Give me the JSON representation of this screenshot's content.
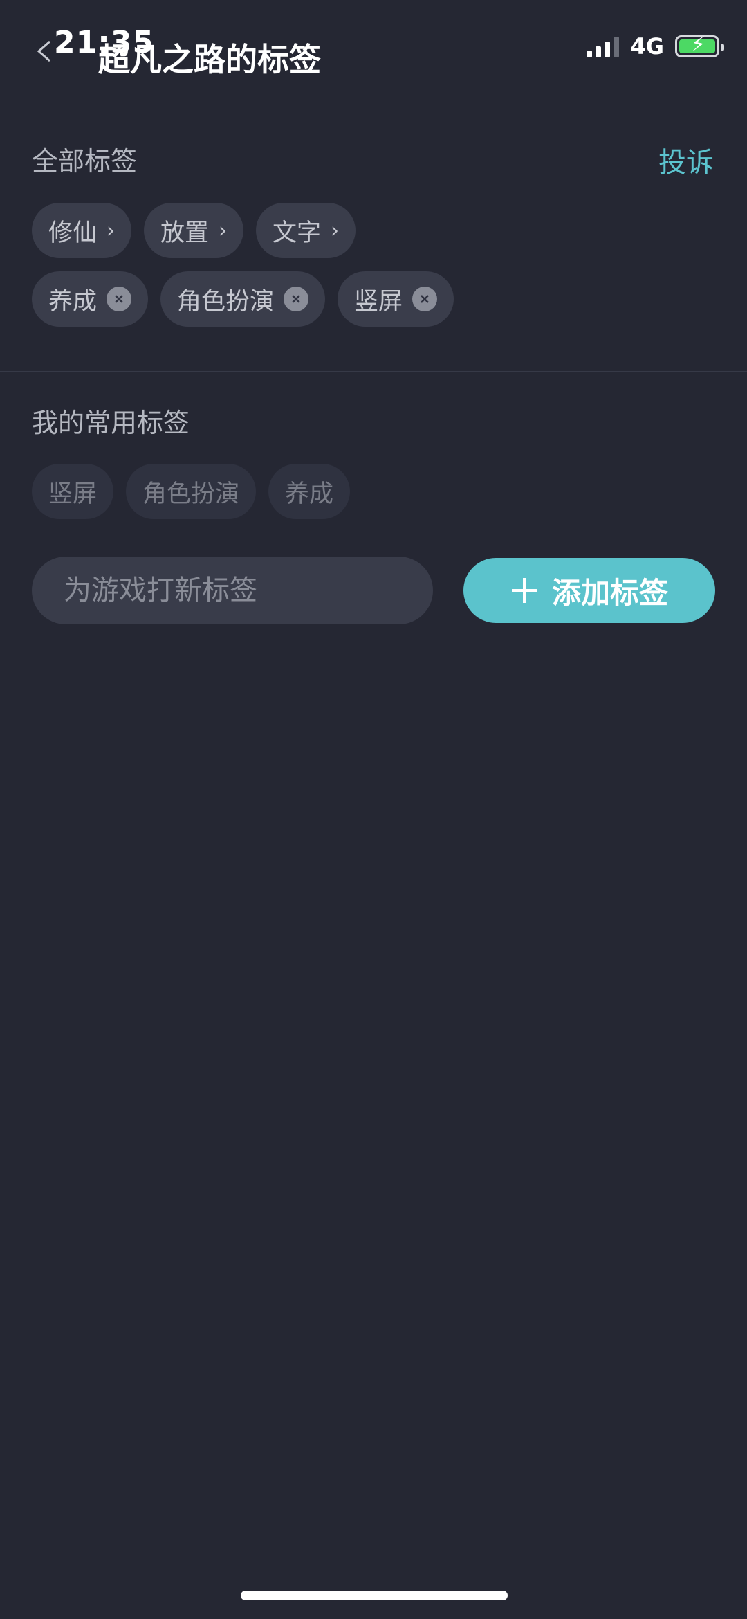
{
  "status_bar": {
    "time": "21:35",
    "network": "4G"
  },
  "header": {
    "title": "超凡之路的标签",
    "back_icon": "back-arrow-icon"
  },
  "all_tags": {
    "title": "全部标签",
    "complaint_label": "投诉",
    "accent_color": "#5cc4cf",
    "row1": [
      {
        "label": "修仙",
        "icon": "chevron-right-icon"
      },
      {
        "label": "放置",
        "icon": "chevron-right-icon"
      },
      {
        "label": "文字",
        "icon": "chevron-right-icon"
      }
    ],
    "row2": [
      {
        "label": "养成",
        "icon": "remove-icon"
      },
      {
        "label": "角色扮演",
        "icon": "remove-icon"
      },
      {
        "label": "竖屏",
        "icon": "remove-icon"
      }
    ]
  },
  "common_tags": {
    "title": "我的常用标签",
    "items": [
      "竖屏",
      "角色扮演",
      "养成"
    ]
  },
  "new_tag": {
    "placeholder": "为游戏打新标签",
    "add_label": "添加标签",
    "button_color": "#5bc3cc"
  }
}
